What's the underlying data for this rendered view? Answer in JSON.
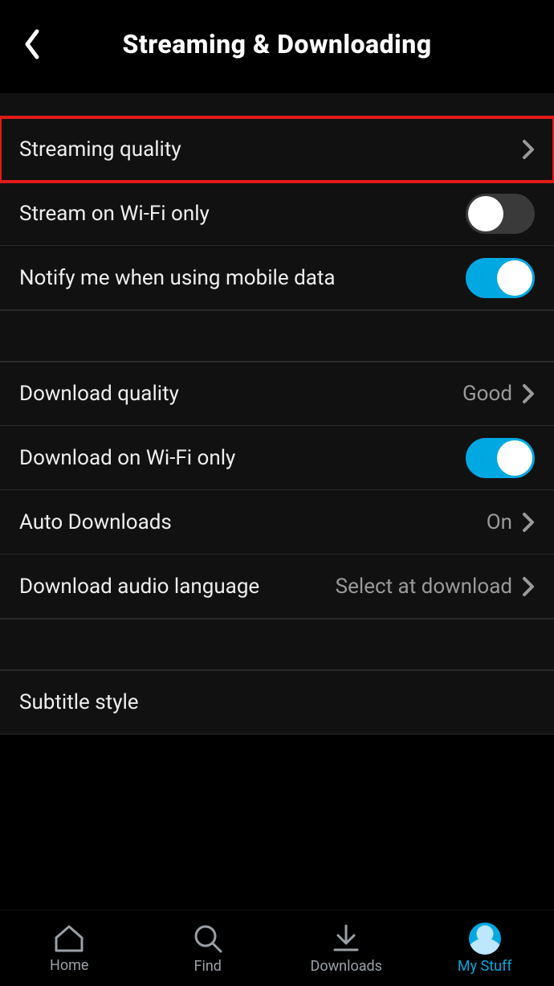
{
  "header": {
    "title": "Streaming & Downloading"
  },
  "streaming": {
    "quality_label": "Streaming quality",
    "wifi_only_label": "Stream on Wi-Fi only",
    "wifi_only_on": false,
    "notify_mobile_label": "Notify me when using mobile data",
    "notify_mobile_on": true
  },
  "download": {
    "quality_label": "Download quality",
    "quality_value": "Good",
    "wifi_only_label": "Download on Wi-Fi only",
    "wifi_only_on": true,
    "auto_label": "Auto Downloads",
    "auto_value": "On",
    "audio_lang_label": "Download audio language",
    "audio_lang_value": "Select at download"
  },
  "subtitle": {
    "style_label": "Subtitle style"
  },
  "nav": {
    "home": "Home",
    "find": "Find",
    "downloads": "Downloads",
    "mystuff": "My Stuff",
    "active": "mystuff"
  },
  "colors": {
    "accent": "#00a8e1",
    "highlight": "#e21b1b"
  }
}
